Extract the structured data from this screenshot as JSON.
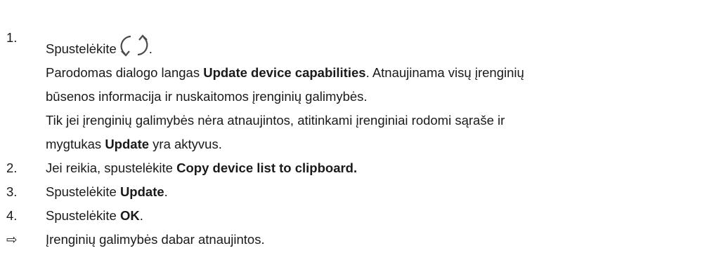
{
  "steps": [
    {
      "num": "1.",
      "text": "Spustelėkite",
      "icon": "refresh-icon",
      "after_icon": ".",
      "para1_a": "Parodomas dialogo langas ",
      "para1_b": "Update device capabilities",
      "para1_c": ". Atnaujinama visų įrenginių",
      "para1_line2": "būsenos informacija ir nuskaitomos įrenginių galimybės.",
      "para2_line1": "Tik jei įrenginių galimybės nėra atnaujintos, atitinkami įrenginiai rodomi sąraše ir",
      "para2_line2_a": "mygtukas ",
      "para2_line2_b": "Update",
      "para2_line2_c": " yra aktyvus."
    },
    {
      "num": "2.",
      "text_a": "Jei reikia, spustelėkite ",
      "text_b": "Copy device list to clipboard."
    },
    {
      "num": "3.",
      "text_a": "Spustelėkite ",
      "text_b": "Update",
      "text_c": "."
    },
    {
      "num": "4.",
      "text_a": "Spustelėkite ",
      "text_b": "OK",
      "text_c": "."
    }
  ],
  "result": {
    "marker": "⇨",
    "text": "Įrenginių galimybės dabar atnaujintos."
  }
}
